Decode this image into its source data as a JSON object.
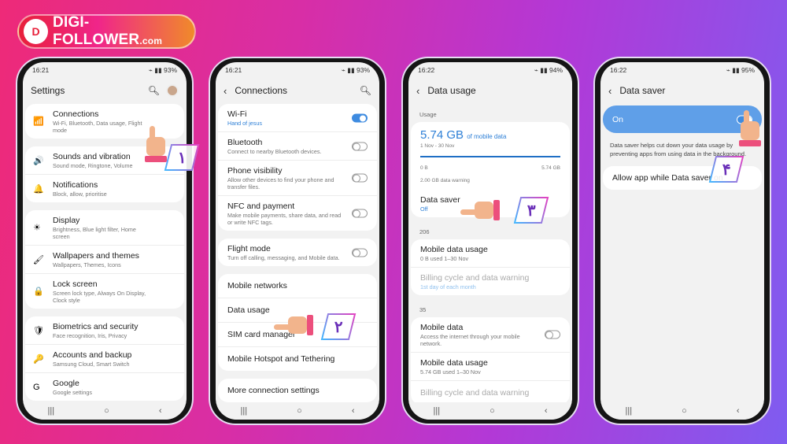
{
  "brand": {
    "logo_text": "DIGI-FOLLOWER",
    "logo_suffix": ".com"
  },
  "colors": {
    "accent": "#3e8be0",
    "toggle_bar": "#5f9fe8",
    "badge_text": "#6a2fb8"
  },
  "steps": [
    "۱",
    "۲",
    "۳",
    "۴"
  ],
  "phones": [
    {
      "status": {
        "time": "16:21",
        "battery": "93%"
      },
      "title": "Settings",
      "back": false,
      "search": true,
      "avatar": true,
      "cards": [
        [
          {
            "icon": "wifi-icon",
            "glyph": "📶",
            "t": "Connections",
            "s": "Wi-Fi, Bluetooth, Data usage, Flight mode"
          }
        ],
        [
          {
            "icon": "speaker-icon",
            "glyph": "🔊",
            "t": "Sounds and vibration",
            "s": "Sound mode, Ringtone, Volume"
          },
          {
            "icon": "notification-icon",
            "glyph": "🔔",
            "t": "Notifications",
            "s": "Block, allow, prioritise"
          }
        ],
        [
          {
            "icon": "brightness-icon",
            "glyph": "☀",
            "t": "Display",
            "s": "Brightness, Blue light filter, Home screen"
          },
          {
            "icon": "brush-icon",
            "glyph": "🖌",
            "t": "Wallpapers and themes",
            "s": "Wallpapers, Themes, Icons"
          },
          {
            "icon": "lock-icon",
            "glyph": "🔒",
            "t": "Lock screen",
            "s": "Screen lock type, Always On Display, Clock style"
          }
        ],
        [
          {
            "icon": "shield-icon",
            "glyph": "🛡",
            "t": "Biometrics and security",
            "s": "Face recognition, Iris, Privacy"
          },
          {
            "icon": "key-icon",
            "glyph": "🔑",
            "t": "Accounts and backup",
            "s": "Samsung Cloud, Smart Switch"
          },
          {
            "icon": "google-icon",
            "glyph": "G",
            "t": "Google",
            "s": "Google settings"
          }
        ]
      ]
    },
    {
      "status": {
        "time": "16:21",
        "battery": "93%"
      },
      "title": "Connections",
      "back": true,
      "search": true,
      "cards": [
        [
          {
            "t": "Wi-Fi",
            "s": "Hand of  jesus",
            "blue": true,
            "toggle": true
          },
          {
            "t": "Bluetooth",
            "s": "Connect to nearby Bluetooth devices.",
            "toggle": false
          },
          {
            "t": "Phone visibility",
            "s": "Allow other devices to find your phone and transfer files.",
            "toggle": false
          },
          {
            "t": "NFC and payment",
            "s": "Make mobile payments, share data, and read or write NFC tags.",
            "toggle": false
          }
        ],
        [
          {
            "t": "Flight mode",
            "s": "Turn off calling, messaging, and Mobile data.",
            "toggle": false
          }
        ],
        [
          {
            "t": "Mobile networks"
          },
          {
            "t": "Data usage"
          },
          {
            "t": "SIM card manager"
          },
          {
            "t": "Mobile Hotspot and Tethering"
          }
        ],
        [
          {
            "t": "More connection settings"
          }
        ]
      ]
    },
    {
      "status": {
        "time": "16:22",
        "battery": "94%"
      },
      "title": "Data usage",
      "back": true,
      "search": false,
      "usage": {
        "section": "Usage",
        "amount": "5.74 GB",
        "amount_suffix": "of mobile data",
        "period": "1 Nov - 30 Nov",
        "min": "0 B",
        "max": "5.74 GB",
        "fill_percent": 100,
        "warning": "2.00 GB data warning"
      },
      "data_saver": {
        "t": "Data saver",
        "s": "Off"
      },
      "sim1": {
        "label": "206",
        "rows": [
          {
            "t": "Mobile data usage",
            "s": "0 B used 1–30 Nov"
          },
          {
            "t": "Billing cycle and data warning",
            "s": "1st day of each month",
            "dim": true
          }
        ]
      },
      "sim2": {
        "label": "35",
        "rows": [
          {
            "t": "Mobile data",
            "s": "Access the internet through your mobile network.",
            "toggle": false
          },
          {
            "t": "Mobile data usage",
            "s": "5.74 GB used 1–30 Nov"
          },
          {
            "t": "Billing cycle and data warning",
            "s": "",
            "dim": true
          }
        ]
      }
    },
    {
      "status": {
        "time": "16:22",
        "battery": "95%"
      },
      "title": "Data saver",
      "back": true,
      "search": false,
      "on_label": "On",
      "on": true,
      "description": "Data saver helps cut down your data usage by preventing apps from using data in the background.",
      "allow_label": "Allow app while Data saver on"
    }
  ]
}
